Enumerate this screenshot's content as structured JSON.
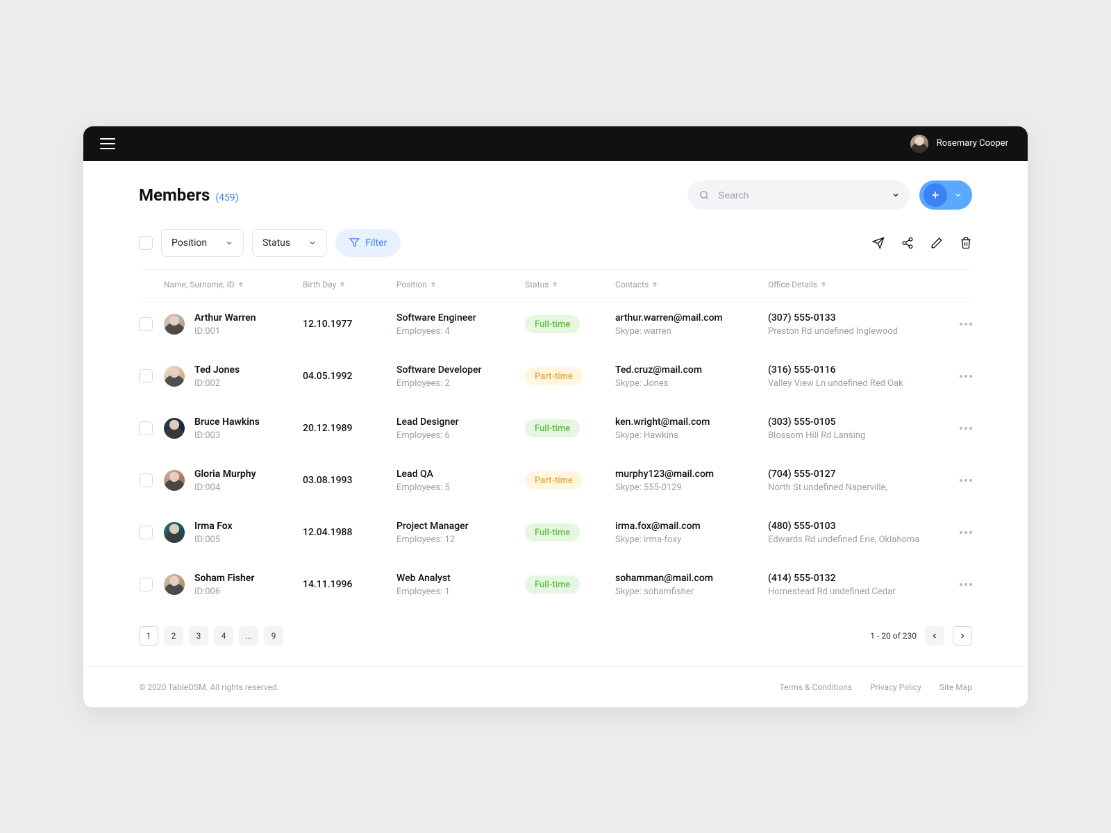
{
  "header": {
    "user_name": "Rosemary Cooper"
  },
  "page": {
    "title": "Members",
    "count": "(459)"
  },
  "search": {
    "placeholder": "Search"
  },
  "filters": {
    "position_label": "Position",
    "status_label": "Status",
    "filter_label": "Filter"
  },
  "columns": {
    "name": "Name, Surname, ID",
    "birth": "Birth Day",
    "position": "Position",
    "status": "Status",
    "contacts": "Contacts",
    "office": "Office Details"
  },
  "rows": [
    {
      "name": "Arthur Warren",
      "id": "ID:001",
      "birth": "12.10.1977",
      "position": "Software Engineer",
      "employees": "Employees: 4",
      "status": "Full-time",
      "status_type": "full",
      "email": "arthur.warren@mail.com",
      "skype": "Skype: warren",
      "phone": "(307) 555-0133",
      "address": "Preston Rd undefined Inglewood"
    },
    {
      "name": "Ted Jones",
      "id": "ID:002",
      "birth": "04.05.1992",
      "position": "Software Developer",
      "employees": "Employees: 2",
      "status": "Part-time",
      "status_type": "part",
      "email": "Ted.cruz@mail.com",
      "skype": "Skype: Jones",
      "phone": "(316) 555-0116",
      "address": "Valley View Ln undefined Red Oak"
    },
    {
      "name": "Bruce Hawkins",
      "id": "ID:003",
      "birth": "20.12.1989",
      "position": "Lead Designer",
      "employees": "Employees: 6",
      "status": "Full-time",
      "status_type": "full",
      "email": "ken.wright@mail.com",
      "skype": "Skype: Hawkins",
      "phone": "(303) 555-0105",
      "address": "Blossom Hill Rd Lansing"
    },
    {
      "name": "Gloria Murphy",
      "id": "ID:004",
      "birth": "03.08.1993",
      "position": "Lead QA",
      "employees": "Employees: 5",
      "status": "Part-time",
      "status_type": "part",
      "email": "murphy123@mail.com",
      "skype": "Skype: 555-0129",
      "phone": "(704) 555-0127",
      "address": "North St undefined Naperville,"
    },
    {
      "name": "Irma Fox",
      "id": "ID:005",
      "birth": "12.04.1988",
      "position": "Project Manager",
      "employees": "Employees: 12",
      "status": "Full-time",
      "status_type": "full",
      "email": "irma.fox@mail.com",
      "skype": "Skype: irma-foxy",
      "phone": "(480) 555-0103",
      "address": "Edwards Rd undefined Erie, Oklahoma"
    },
    {
      "name": "Soham Fisher",
      "id": "ID:006",
      "birth": "14.11.1996",
      "position": "Web Analyst",
      "employees": "Employees: 1",
      "status": "Full-time",
      "status_type": "full",
      "email": "sohamman@mail.com",
      "skype": "Skype: sohamfisher",
      "phone": "(414) 555-0132",
      "address": "Homestead Rd undefined Cedar"
    }
  ],
  "pagination": {
    "pages": [
      "1",
      "2",
      "3",
      "4",
      "...",
      "9"
    ],
    "active": "1",
    "range": "1 - 20 of 230"
  },
  "footer": {
    "copyright": "© 2020 TableDSM. All rights reserved.",
    "links": [
      "Terms & Conditions",
      "Privacy Policy",
      "Site Map"
    ]
  }
}
